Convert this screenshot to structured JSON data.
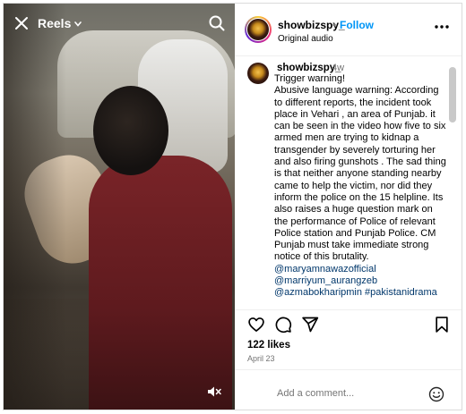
{
  "video": {
    "label": "Reels"
  },
  "post": {
    "username": "showbizspy_",
    "separator": "•",
    "follow_label": "Follow",
    "audio": "Original audio",
    "time_ago": "4w",
    "caption_lines": [
      "Trigger warning!",
      "Abusive language warning: According",
      "to different reports, the incident took",
      "place in Vehari , an area of Punjab. it",
      "can be seen in the video how five to six",
      "armed men are trying to kidnap a",
      "transgender by severely torturing her",
      "and also firing gunshots . The sad thing",
      "is that neither anyone standing nearby",
      "came to help the victim, nor did they",
      "inform the police on the 15 helpline. Its",
      "also raises a huge question mark on",
      "the performance of Police of relevant",
      "Police station and Punjab Police. CM",
      "Punjab must take immediate strong",
      "notice of this brutality."
    ],
    "tags": [
      "@maryamnawazofficial",
      "@marriyum_aurangzeb",
      "@azmabokharipmin #pakistanidrama"
    ],
    "likes": "122 likes",
    "date": "April 23",
    "comment_placeholder": "Add a comment..."
  },
  "icons": {
    "close": "close-icon",
    "chevron": "chevron-down-icon",
    "search": "search-icon",
    "mute": "mute-icon",
    "more": "more-options-icon",
    "like": "heart-icon",
    "comment": "comment-icon",
    "share": "share-icon",
    "save": "bookmark-icon",
    "emoji": "emoji-icon"
  },
  "colors": {
    "follow": "#0095f6",
    "tag": "#00376b",
    "muted_text": "#737373"
  }
}
